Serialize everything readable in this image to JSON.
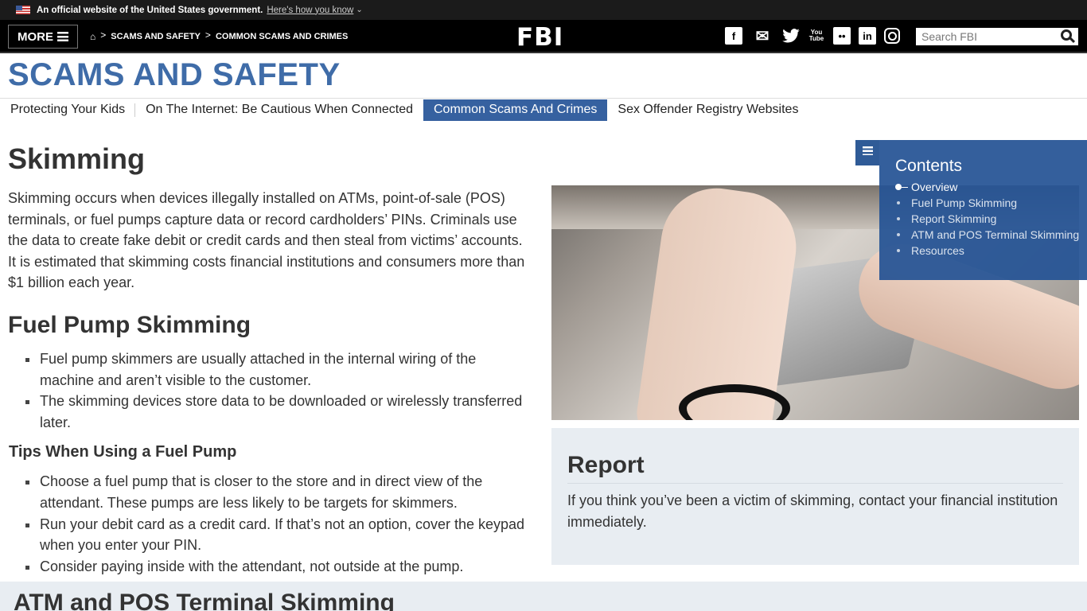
{
  "gov_banner": {
    "text": "An official website of the United States government.",
    "link": "Here's how you know",
    "flag_icon": "us-flag-icon",
    "chevron": "⌄"
  },
  "topnav": {
    "more_label": "MORE",
    "breadcrumbs": [
      "SCAMS AND SAFETY",
      "COMMON SCAMS AND CRIMES"
    ],
    "breadcrumb_separator": ">",
    "home_icon": "⌂",
    "logo": "FBI",
    "social": [
      {
        "name": "facebook",
        "glyph": "f"
      },
      {
        "name": "email",
        "glyph": "✉"
      },
      {
        "name": "twitter",
        "glyph": "🐦"
      },
      {
        "name": "youtube",
        "glyph_top": "You",
        "glyph_bottom": "Tube"
      },
      {
        "name": "flickr",
        "glyph": "••"
      },
      {
        "name": "linkedin",
        "glyph": "in"
      },
      {
        "name": "instagram",
        "glyph": ""
      }
    ],
    "search_placeholder": "Search FBI"
  },
  "section": {
    "title": "SCAMS AND SAFETY",
    "tabs": [
      {
        "label": "Protecting Your Kids",
        "active": false
      },
      {
        "label": "On The Internet: Be Cautious When Connected",
        "active": false
      },
      {
        "label": "Common Scams And Crimes",
        "active": true
      },
      {
        "label": "Sex Offender Registry Websites",
        "active": false
      }
    ]
  },
  "article": {
    "title": "Skimming",
    "intro": "Skimming occurs when devices illegally installed on ATMs, point-of-sale (POS) terminals, or fuel pumps capture data or record cardholders’ PINs. Criminals use the data to create fake debit or credit cards and then steal from victims’ accounts. It is estimated that skimming costs financial institutions and consumers more than $1 billion each year.",
    "fuel_heading": "Fuel Pump Skimming",
    "fuel_bullets": [
      "Fuel pump skimmers are usually attached in the internal wiring of the machine and aren’t visible to the customer.",
      "The skimming devices store data to be downloaded or wirelessly transferred later."
    ],
    "tips_heading": "Tips When Using a Fuel Pump",
    "tips_bullets": [
      "Choose a fuel pump that is closer to the store and in direct view of the attendant. These pumps are less likely to be targets for skimmers.",
      "Run your debit card as a credit card. If that’s not an option, cover the keypad when you enter your PIN.",
      "Consider paying inside with the attendant, not outside at the pump."
    ],
    "atm_heading": "ATM and POS Terminal Skimming"
  },
  "toc": {
    "title": "Contents",
    "items": [
      {
        "label": "Overview",
        "current": true
      },
      {
        "label": "Fuel Pump Skimming",
        "current": false
      },
      {
        "label": "Report Skimming",
        "current": false
      },
      {
        "label": "ATM and POS Terminal Skimming",
        "current": false
      },
      {
        "label": "Resources",
        "current": false
      }
    ]
  },
  "report": {
    "heading": "Report",
    "text": "If you think you’ve been a victim of skimming, contact your financial institution immediately."
  },
  "colors": {
    "brand_blue": "#3f6ca8",
    "active_tab": "#3661a0",
    "toc_bg": "#255394",
    "panel_bg": "#e8edf2",
    "nav_bg": "#000000"
  }
}
